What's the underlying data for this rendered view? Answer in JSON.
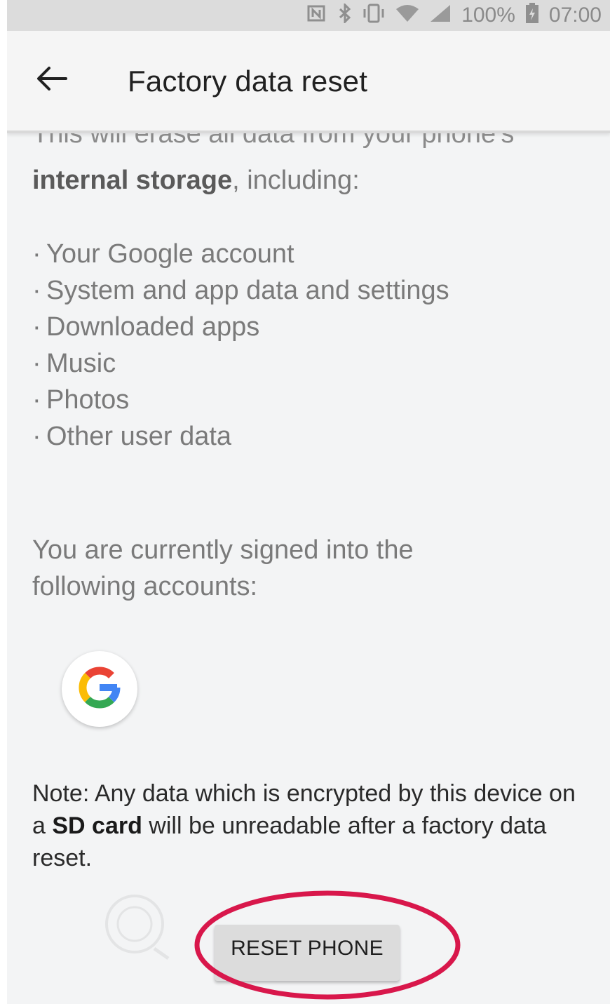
{
  "status_bar": {
    "icons": [
      "nfc-icon",
      "bluetooth-icon",
      "vibrate-icon",
      "wifi-icon",
      "signal-icon",
      "battery-icon"
    ],
    "battery_percent": "100%",
    "time": "07:00"
  },
  "app_bar": {
    "back_icon": "arrow-back-icon",
    "title": "Factory data reset"
  },
  "content": {
    "intro_cut": "This will erase all data from your phone's",
    "intro_bold": "internal storage",
    "intro_rest": ", including:",
    "items": [
      "Your Google account",
      "System and app data and settings",
      "Downloaded apps",
      "Music",
      "Photos",
      "Other user data"
    ],
    "accounts_line1": "You are currently signed into the",
    "accounts_line2": "following accounts:",
    "account_icon": "google-g-icon",
    "note_part1": "Note: Any data which is encrypted by this device on a ",
    "note_bold": "SD card",
    "note_part2": " will be unreadable after a factory data reset."
  },
  "actions": {
    "reset_label": "RESET PHONE"
  },
  "colors": {
    "highlight_ring": "#d8174b",
    "google_blue": "#4285F4",
    "google_red": "#EA4335",
    "google_yellow": "#FBBC05",
    "google_green": "#34A853"
  }
}
